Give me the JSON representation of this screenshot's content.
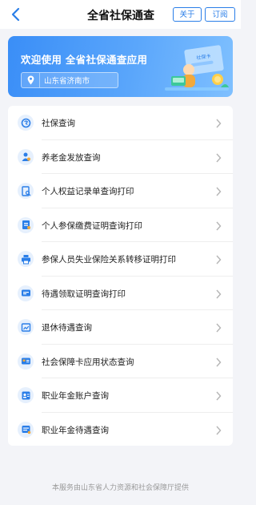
{
  "header": {
    "title": "全省社保通查",
    "about_label": "关于",
    "subscribe_label": "订阅"
  },
  "banner": {
    "welcome": "欢迎使用 全省社保通查应用",
    "location": "山东省济南市",
    "card_text": "社保卡"
  },
  "menu": [
    {
      "label": "社保查询",
      "icon": "social-security-logo-icon"
    },
    {
      "label": "养老金发放查询",
      "icon": "pension-person-icon"
    },
    {
      "label": "个人权益记录单查询打印",
      "icon": "record-search-icon"
    },
    {
      "label": "个人参保缴费证明查询打印",
      "icon": "payment-proof-icon"
    },
    {
      "label": "参保人员失业保险关系转移证明打印",
      "icon": "printer-icon"
    },
    {
      "label": "待遇领取证明查询打印",
      "icon": "certificate-icon"
    },
    {
      "label": "退休待遇查询",
      "icon": "retirement-card-icon"
    },
    {
      "label": "社会保障卡应用状态查询",
      "icon": "ss-card-icon"
    },
    {
      "label": "职业年金账户查询",
      "icon": "annuity-account-icon"
    },
    {
      "label": "职业年金待遇查询",
      "icon": "annuity-benefit-icon"
    }
  ],
  "footer": "本服务由山东省人力资源和社会保障厅提供",
  "colors": {
    "accent": "#2a7ee8",
    "banner_start": "#3a8ef7",
    "icon_bg": "#e6f0fd",
    "page_bg": "#f3f4f8"
  }
}
